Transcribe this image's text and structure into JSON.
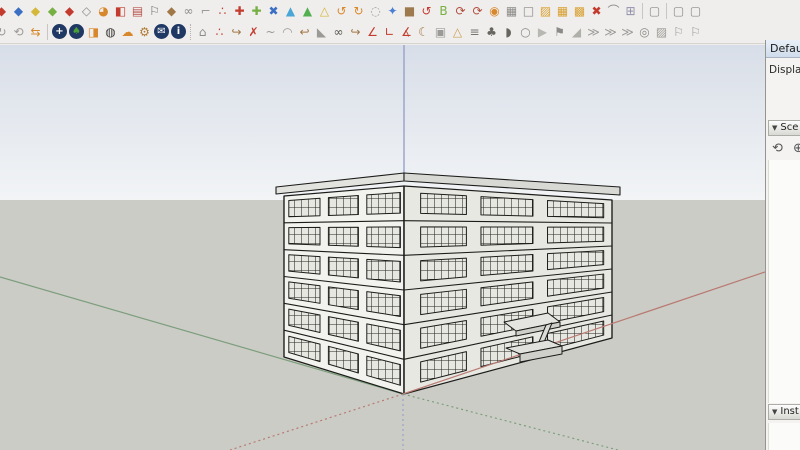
{
  "toolbar": {
    "row1": [
      {
        "name": "plugin-red-diamond-icon",
        "glyph": "◆",
        "color": "#c23b2e"
      },
      {
        "name": "plugin-blue-diamond-icon",
        "glyph": "◆",
        "color": "#3a6fc4"
      },
      {
        "name": "plugin-yellow-diamond-icon",
        "glyph": "◆",
        "color": "#d4b83a"
      },
      {
        "name": "plugin-green-diamond-icon",
        "glyph": "◆",
        "color": "#76b043"
      },
      {
        "name": "plugin-red-diamond2-icon",
        "glyph": "◆",
        "color": "#c23b2e"
      },
      {
        "name": "plugin-white-diamond-icon",
        "glyph": "◇",
        "color": "#8a8a86"
      },
      {
        "name": "pie-tool-icon",
        "glyph": "◕",
        "color": "#d8882c"
      },
      {
        "name": "half-square-tool-icon",
        "glyph": "◧",
        "color": "#c23b2e"
      },
      {
        "name": "ledger-tool-icon",
        "glyph": "▤",
        "color": "#b8524a"
      },
      {
        "name": "flag-tool-icon",
        "glyph": "⚐",
        "color": "#6a6a66"
      },
      {
        "name": "brown-prism-tool-icon",
        "glyph": "◆",
        "color": "#a07848"
      },
      {
        "name": "glasses-tool-icon",
        "glyph": "∞",
        "color": "#8a8a86"
      },
      {
        "name": "angle-bracket-tool-icon",
        "glyph": "⌐",
        "color": "#9a9a96"
      },
      {
        "name": "dotted-path-tool-icon",
        "glyph": "∴",
        "color": "#c23b2e"
      },
      {
        "name": "red-cross-tool-icon",
        "glyph": "✚",
        "color": "#c23b2e"
      },
      {
        "name": "green-cross-tool-icon",
        "glyph": "✚",
        "color": "#76b043"
      },
      {
        "name": "blue-x-tool-icon",
        "glyph": "✖",
        "color": "#3a6fc4"
      },
      {
        "name": "blue-droplet-tool-icon",
        "glyph": "▲",
        "color": "#4aa6d6"
      },
      {
        "name": "green-droplet-tool-icon",
        "glyph": "▲",
        "color": "#52b050"
      },
      {
        "name": "yellow-triangle-tool-icon",
        "glyph": "△",
        "color": "#d4b83a"
      },
      {
        "name": "orange-hook-tool-icon",
        "glyph": "↺",
        "color": "#d8882c"
      },
      {
        "name": "orange-double-hook-tool-icon",
        "glyph": "↻",
        "color": "#d8882c"
      },
      {
        "name": "ring-tool-icon",
        "glyph": "◌",
        "color": "#9a9a96"
      },
      {
        "name": "compass-star-tool-icon",
        "glyph": "✦",
        "color": "#4a7fd4"
      },
      {
        "name": "brown-box-tool-icon",
        "glyph": "■",
        "color": "#9c7a4e"
      },
      {
        "name": "red-swirl-tool-icon",
        "glyph": "↺",
        "color": "#c23b2e"
      },
      {
        "name": "green-b-tool-icon",
        "glyph": "B",
        "color": "#76b043"
      },
      {
        "name": "rotate-box1-tool-icon",
        "glyph": "⟳",
        "color": "#b05040"
      },
      {
        "name": "rotate-box2-tool-icon",
        "glyph": "⟳",
        "color": "#b05040"
      },
      {
        "name": "orange-target-tool-icon",
        "glyph": "◉",
        "color": "#d8882c"
      },
      {
        "name": "checker-pair-tool-icon",
        "glyph": "▦",
        "color": "#8a8a86"
      },
      {
        "name": "wire-box-tool-icon",
        "glyph": "□",
        "color": "#8a8a86"
      },
      {
        "name": "hatch-square-tool-icon",
        "glyph": "▨",
        "color": "#d8a030"
      },
      {
        "name": "grid-2x2-tool-icon",
        "glyph": "▦",
        "color": "#d8a030"
      },
      {
        "name": "grid-3x3-tool-icon",
        "glyph": "▩",
        "color": "#d8a030"
      },
      {
        "name": "red-xx-tool-icon",
        "glyph": "✖",
        "color": "#c23b2e"
      },
      {
        "name": "arc-handles-tool-icon",
        "glyph": "⌒",
        "color": "#8a8a86"
      },
      {
        "name": "tile-grid-tool-icon",
        "glyph": "⊞",
        "color": "#9090a8"
      },
      {
        "sep": true
      },
      {
        "name": "gray-stack-tool-icon",
        "glyph": "▢",
        "color": "#8a8a86"
      },
      {
        "sep": true
      },
      {
        "name": "gray-box-pair1-tool-icon",
        "glyph": "▢",
        "color": "#8a8a86"
      },
      {
        "name": "gray-box-pair2-tool-icon",
        "glyph": "▢",
        "color": "#8a8a86"
      }
    ],
    "row2": [
      {
        "name": "refresh-c-tool-icon",
        "glyph": "↻",
        "color": "#9a9a96"
      },
      {
        "name": "sync-tool-icon",
        "glyph": "⟲",
        "color": "#9a9a96"
      },
      {
        "name": "swap-arrows-tool-icon",
        "glyph": "⇆",
        "color": "#d8882c"
      },
      {
        "sep": true
      },
      {
        "name": "add-circle-tool-icon",
        "glyph": "+",
        "color": "#ffffff",
        "circle": "#1f3864"
      },
      {
        "name": "tree-circle-tool-icon",
        "glyph": "♠",
        "color": "#4a9e3a",
        "circle": "#1f3864"
      },
      {
        "name": "layers-tool-icon",
        "glyph": "◨",
        "color": "#d8882c"
      },
      {
        "name": "checker-sphere-tool-icon",
        "glyph": "◍",
        "color": "#3a3a38"
      },
      {
        "name": "cloud-upload-tool-icon",
        "glyph": "☁",
        "color": "#d8882c"
      },
      {
        "name": "gear-tool-icon",
        "glyph": "⚙",
        "color": "#b07830"
      },
      {
        "name": "envelope-tool-icon",
        "glyph": "✉",
        "color": "#ffffff",
        "circle": "#1f3864"
      },
      {
        "name": "info-tool-icon",
        "glyph": "i",
        "color": "#ffffff",
        "circle": "#1f3864"
      },
      {
        "dotsep": true
      },
      {
        "name": "polygon-flag-tool-icon",
        "glyph": "⌂",
        "color": "#8a8a86"
      },
      {
        "name": "dot-curve-tool-icon",
        "glyph": "∴",
        "color": "#c23b2e"
      },
      {
        "name": "send-arrow-tool-icon",
        "glyph": "↪",
        "color": "#a07848"
      },
      {
        "name": "x-line-tool-icon",
        "glyph": "✗",
        "color": "#c23b2e"
      },
      {
        "name": "blob-pair-tool-icon",
        "glyph": "~",
        "color": "#9a9a96"
      },
      {
        "name": "animal-tool-icon",
        "glyph": "◠",
        "color": "#9a9a96"
      },
      {
        "name": "curve-arrow-tool-icon",
        "glyph": "↩",
        "color": "#a07848"
      },
      {
        "name": "fold-triangle-tool-icon",
        "glyph": "◣",
        "color": "#9a9a96"
      },
      {
        "name": "goggles-tool-icon",
        "glyph": "∞",
        "color": "#55554f"
      },
      {
        "name": "hook-arrow-tool-icon",
        "glyph": "↪",
        "color": "#a07848"
      },
      {
        "name": "red-angle1-tool-icon",
        "glyph": "∠",
        "color": "#c23b2e"
      },
      {
        "name": "red-angle2-tool-icon",
        "glyph": "∟",
        "color": "#c23b2e"
      },
      {
        "name": "red-angle3-tool-icon",
        "glyph": "∡",
        "color": "#c23b2e"
      },
      {
        "name": "crescent-tool-icon",
        "glyph": "☾",
        "color": "#a07848"
      },
      {
        "name": "box-sphere-tool-icon",
        "glyph": "▣",
        "color": "#9a9a96"
      },
      {
        "name": "cone-tool-icon",
        "glyph": "△",
        "color": "#c8a050"
      },
      {
        "name": "column-stack-tool-icon",
        "glyph": "≡",
        "color": "#77776f"
      },
      {
        "name": "forest-tool-icon",
        "glyph": "♣",
        "color": "#66665f"
      },
      {
        "name": "dome-tool-icon",
        "glyph": "◗",
        "color": "#66665f"
      },
      {
        "name": "polygon2-tool-icon",
        "glyph": "○",
        "color": "#8a8a86"
      },
      {
        "name": "arrow-shape-tool-icon",
        "glyph": "▶",
        "color": "#b8b8b2"
      },
      {
        "name": "flag-banner-tool-icon",
        "glyph": "⚑",
        "color": "#8a8a86"
      },
      {
        "name": "ramp-tool-icon",
        "glyph": "◢",
        "color": "#b0b0aa"
      },
      {
        "name": "chevron1-tool-icon",
        "glyph": "≫",
        "color": "#9a9a96"
      },
      {
        "name": "chevron2-tool-icon",
        "glyph": "≫",
        "color": "#9a9a96"
      },
      {
        "name": "chevron3-tool-icon",
        "glyph": "≫",
        "color": "#9a9a96"
      },
      {
        "name": "snail-tool-icon",
        "glyph": "◎",
        "color": "#8a8a86"
      },
      {
        "name": "ramp-stack-tool-icon",
        "glyph": "▨",
        "color": "#9a9a96"
      },
      {
        "name": "page-flag-tool-icon",
        "glyph": "⚐",
        "color": "#9a9a96"
      },
      {
        "name": "banner-pole-tool-icon",
        "glyph": "⚐",
        "color": "#9a9a96"
      }
    ]
  },
  "right_panel": {
    "title": "Default",
    "display_label": "Display:",
    "scenes_section": {
      "collapse_icon": "▼",
      "label": "Sce"
    },
    "instructor_section": {
      "collapse_icon": "▼",
      "label": "Inst"
    },
    "scene_toolbar": [
      {
        "name": "refresh-scene-icon",
        "glyph": "⟲",
        "color": "#555555"
      },
      {
        "name": "add-scene-icon",
        "glyph": "⊕",
        "color": "#555555"
      }
    ]
  },
  "viewport": {
    "model": "six-story frame building",
    "stories": 6,
    "colors": {
      "sky_top": "#d8dee8",
      "sky_bottom": "#f2f4f6",
      "ground": "#cbccc6",
      "axis_red": "#b97a72",
      "axis_green": "#7d9e7d",
      "axis_blue": "#98a1c8",
      "edge": "#1c1c1a",
      "face_left": "#f2f2ee",
      "face_right": "#e8e8e3",
      "roof_left": "#e2e2de",
      "roof_right": "#d8d8d4"
    }
  }
}
